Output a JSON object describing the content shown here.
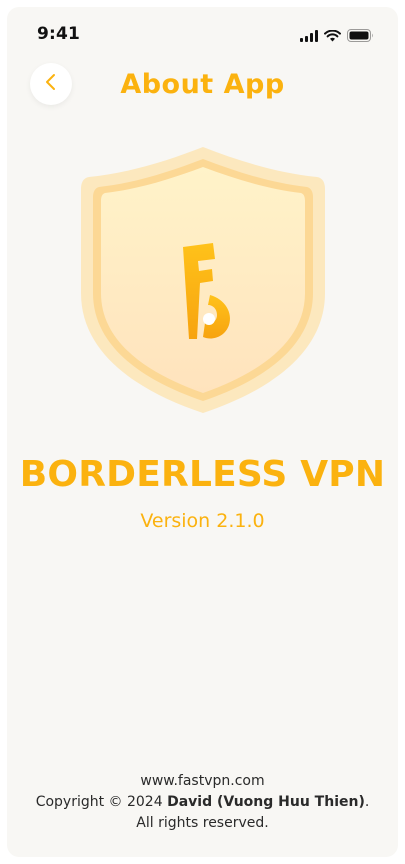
{
  "status_bar": {
    "time": "9:41",
    "icons": [
      "cellular-signal-icon",
      "wifi-icon",
      "battery-icon"
    ]
  },
  "header": {
    "back_icon": "chevron-left-icon",
    "title": "About App"
  },
  "app": {
    "logo_icon": "shield-logo-icon",
    "name": "BORDERLESS VPN",
    "version": "Version 2.1.0"
  },
  "footer": {
    "website": "www.fastvpn.com",
    "copyright_prefix": "Copyright © 2024 ",
    "author": "David (Vuong Huu Thien)",
    "copyright_suffix": ".",
    "rights": "All rights reserved."
  },
  "colors": {
    "accent": "#FBB20F",
    "background": "#F8F7F4",
    "text_dark": "#2A2A2A"
  }
}
